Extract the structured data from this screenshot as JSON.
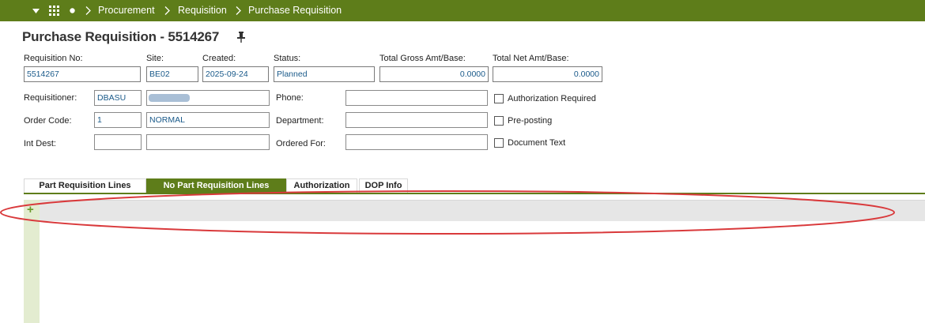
{
  "nav": {
    "breadcrumbs": [
      "Procurement",
      "Requisition",
      "Purchase Requisition"
    ]
  },
  "page": {
    "title": "Purchase Requisition - 5514267"
  },
  "header": {
    "requisition_no": {
      "label": "Requisition No:",
      "value": "5514267"
    },
    "site": {
      "label": "Site:",
      "value": "BE02"
    },
    "created": {
      "label": "Created:",
      "value": "2025-09-24"
    },
    "status": {
      "label": "Status:",
      "value": "Planned"
    },
    "total_gross": {
      "label": "Total Gross Amt/Base:",
      "value": "0.0000"
    },
    "total_net": {
      "label": "Total Net Amt/Base:",
      "value": "0.0000"
    }
  },
  "form": {
    "requisitioner": {
      "label": "Requisitioner:",
      "value": "DBASU",
      "name_value": ""
    },
    "order_code": {
      "label": "Order Code:",
      "value": "1",
      "name_value": "NORMAL"
    },
    "int_dest": {
      "label": "Int Dest:",
      "value": "",
      "name_value": ""
    },
    "phone": {
      "label": "Phone:",
      "value": ""
    },
    "department": {
      "label": "Department:",
      "value": ""
    },
    "ordered_for": {
      "label": "Ordered For:",
      "value": ""
    },
    "authorization_required": {
      "label": "Authorization Required",
      "checked": false
    },
    "pre_posting": {
      "label": "Pre-posting",
      "checked": false
    },
    "document_text": {
      "label": "Document Text",
      "checked": false
    }
  },
  "tabs": [
    {
      "label": "Part Requisition Lines",
      "active": false
    },
    {
      "label": "No Part Requisition Lines",
      "active": true
    },
    {
      "label": "Authorization",
      "active": false
    },
    {
      "label": "DOP Info",
      "active": false
    }
  ],
  "grid": {
    "add_symbol": "+"
  },
  "colors": {
    "brand_green": "#5e7d1a",
    "field_text": "#1a5a8a",
    "annotation_red": "#d9393b",
    "rail_green": "#e3ecd0"
  },
  "icons": [
    "menu-dropdown-icon",
    "apps-grid-icon",
    "dot-icon",
    "chevron-right-icon",
    "pin-icon",
    "add-icon"
  ]
}
